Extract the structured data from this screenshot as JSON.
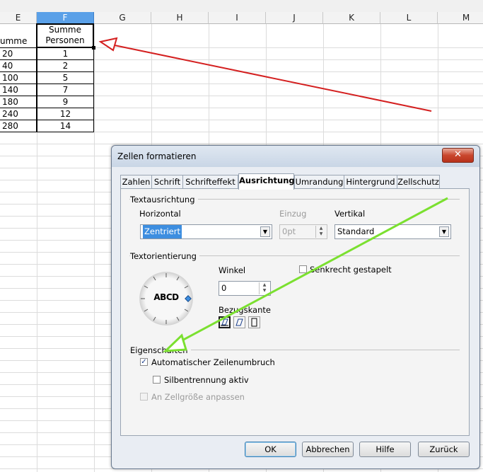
{
  "spreadsheet": {
    "columns": [
      "E",
      "F",
      "G",
      "H",
      "I",
      "J",
      "K",
      "L",
      "M"
    ],
    "selected_column": "F",
    "header_e": "umme",
    "header_f_line1": "Summe",
    "header_f_line2": "Personen",
    "rows": [
      {
        "e": "20",
        "f": "1"
      },
      {
        "e": "40",
        "f": "2"
      },
      {
        "e": "100",
        "f": "5"
      },
      {
        "e": "140",
        "f": "7"
      },
      {
        "e": "180",
        "f": "9"
      },
      {
        "e": "240",
        "f": "12"
      },
      {
        "e": "280",
        "f": "14"
      }
    ]
  },
  "dialog": {
    "title": "Zellen formatieren",
    "close_label": "✕",
    "tabs": [
      "Zahlen",
      "Schrift",
      "Schrifteffekt",
      "Ausrichtung",
      "Umrandung",
      "Hintergrund",
      "Zellschutz"
    ],
    "active_tab": "Ausrichtung",
    "sections": {
      "textausrichtung": "Textausrichtung",
      "textorientierung": "Textorientierung",
      "eigenschaften": "Eigenschaften"
    },
    "horizontal_label": "Horizontal",
    "horizontal_value": "Zentriert",
    "einzug_label": "Einzug",
    "einzug_value": "0pt",
    "vertikal_label": "Vertikal",
    "vertikal_value": "Standard",
    "winkel_label": "Winkel",
    "winkel_value": "0",
    "dial_text": "ABCD",
    "senkrecht_label": "Senkrecht gestapelt",
    "bezugskante_label": "Bezugskante",
    "auto_umbruch_label": "Automatischer Zeilenumbruch",
    "auto_umbruch_checked": true,
    "silbentrennung_label": "Silbentrennung aktiv",
    "zellgroesse_label": "An Zellgröße anpassen",
    "buttons": {
      "ok": "OK",
      "abbrechen": "Abbrechen",
      "hilfe": "Hilfe",
      "zurueck": "Zurück"
    }
  },
  "colors": {
    "selected_header": "#5aa0e8",
    "red_arrow": "#d42020",
    "green_arrow": "#7be030",
    "highlight": "#3d8ee0"
  }
}
